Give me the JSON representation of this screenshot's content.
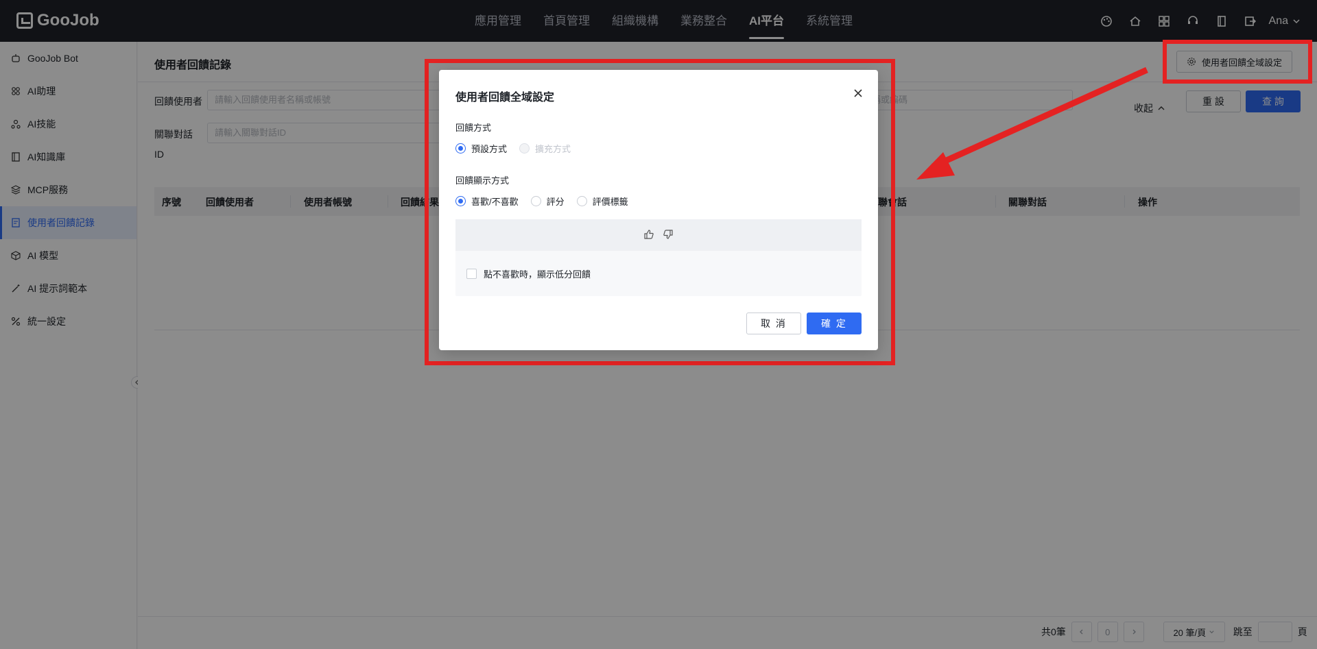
{
  "topbar": {
    "logo": "GooJob",
    "nav": [
      "應用管理",
      "首頁管理",
      "組織機構",
      "業務整合",
      "AI平台",
      "系統管理"
    ],
    "active_nav": "AI平台",
    "icons": [
      "palette-icon",
      "home-icon",
      "apps-icon",
      "support-icon",
      "book-icon",
      "import-icon"
    ],
    "user": "Ana"
  },
  "sidebar": {
    "items": [
      {
        "label": "GooJob Bot",
        "icon": "bot-icon"
      },
      {
        "label": "AI助理",
        "icon": "grid-icon"
      },
      {
        "label": "AI技能",
        "icon": "skill-icon"
      },
      {
        "label": "AI知識庫",
        "icon": "book-icon"
      },
      {
        "label": "MCP服務",
        "icon": "layers-icon"
      },
      {
        "label": "使用者回饋記錄",
        "icon": "feedback-icon"
      },
      {
        "label": "AI 模型",
        "icon": "cube-icon"
      },
      {
        "label": "AI 提示詞範本",
        "icon": "wand-icon"
      },
      {
        "label": "統一設定",
        "icon": "tools-icon"
      }
    ],
    "active_index": 5
  },
  "main": {
    "title": "使用者回饋記錄",
    "settings_button": "使用者回饋全域設定",
    "filters": {
      "feedback_user_label": "回饋使用者",
      "feedback_user_placeholder": "請輸入回饋使用者名稱或帳號",
      "related_dialog_label": "關聯對話",
      "related_dialog_label_2": "ID",
      "related_dialog_placeholder": "請輸入關聯對話ID",
      "third_placeholder_fragment": "稱或編碼"
    },
    "collapse_label": "收起",
    "reset_button": "重 設",
    "query_button": "查 詢",
    "table_headers": [
      "序號",
      "回饋使用者",
      "使用者帳號",
      "回饋結果",
      "關聯會話",
      "關聯對話",
      "操作"
    ],
    "pagination": {
      "total": "共0筆",
      "current_page": "0",
      "page_size": "20 筆/頁",
      "goto_label": "跳至",
      "page_suffix": "頁"
    }
  },
  "modal": {
    "title": "使用者回饋全域設定",
    "feedback_method_label": "回饋方式",
    "feedback_methods": [
      {
        "label": "預設方式",
        "checked": true,
        "disabled": false
      },
      {
        "label": "擴充方式",
        "checked": false,
        "disabled": true
      }
    ],
    "display_method_label": "回饋顯示方式",
    "display_methods": [
      {
        "label": "喜歡/不喜歡",
        "checked": true
      },
      {
        "label": "評分",
        "checked": false
      },
      {
        "label": "評價標籤",
        "checked": false
      }
    ],
    "dislike_option": "點不喜歡時，顯示低分回饋",
    "cancel_button": "取 消",
    "confirm_button": "確 定"
  },
  "colors": {
    "primary": "#2f6bf2",
    "topbar_bg": "#1f2129",
    "annotation": "#e42222"
  }
}
